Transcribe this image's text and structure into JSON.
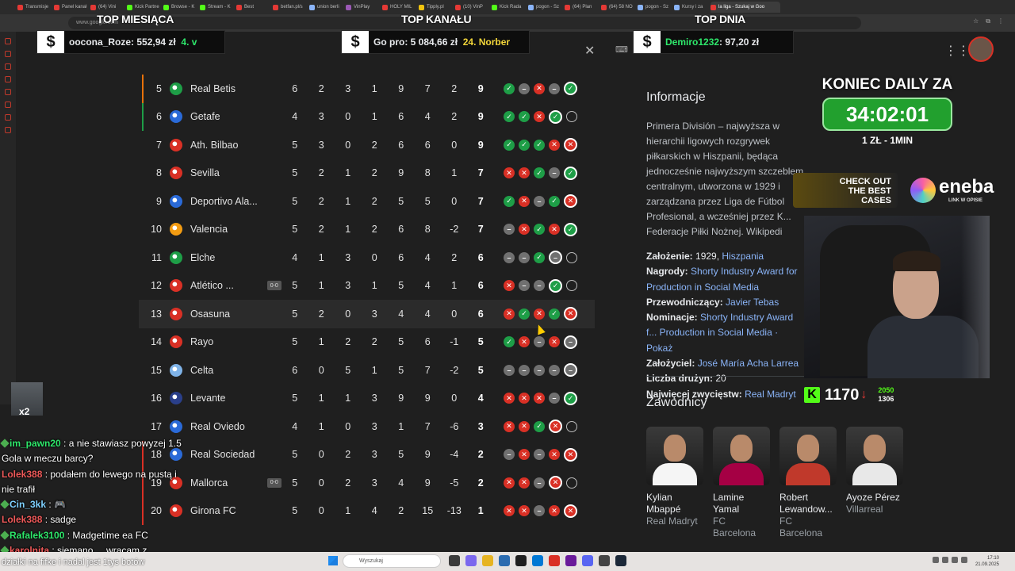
{
  "browser": {
    "tabs": [
      {
        "label": "Transmisje",
        "color": "#e53935"
      },
      {
        "label": "Panel kanał",
        "color": "#e53935"
      },
      {
        "label": "(64) Vini",
        "color": "#e53935"
      },
      {
        "label": "Kick Partne",
        "color": "#53fc18"
      },
      {
        "label": "Browse - K",
        "color": "#53fc18"
      },
      {
        "label": "Stream - K",
        "color": "#53fc18"
      },
      {
        "label": "Best",
        "color": "#e53935"
      },
      {
        "label": "betfan.pl/s",
        "color": "#e53935"
      },
      {
        "label": "union berli",
        "color": "#8ab4f8"
      },
      {
        "label": "VinPlay",
        "color": "#9b59b6"
      },
      {
        "label": "HOLY MIL",
        "color": "#e53935"
      },
      {
        "label": "Tipply.pl",
        "color": "#f1c40f"
      },
      {
        "label": "(10) VinP",
        "color": "#e53935"
      },
      {
        "label": "Kick Rada",
        "color": "#53fc18"
      },
      {
        "label": "pogon - Sz",
        "color": "#8ab4f8"
      },
      {
        "label": "(64) Plan",
        "color": "#e53935"
      },
      {
        "label": "(64) 58 NO",
        "color": "#e53935"
      },
      {
        "label": "pogon - Sz",
        "color": "#8ab4f8"
      },
      {
        "label": "Kursy i za",
        "color": "#8ab4f8"
      },
      {
        "label": "la liga - Szukaj w Goo",
        "color": "#e53935",
        "active": true
      }
    ],
    "address": "www.google.com"
  },
  "overlay": {
    "top_month": {
      "title": "TOP MIESIĄCA",
      "badge": "$",
      "name": "oocona_Roze",
      "amount": "552,94 zł",
      "extra": "4. v"
    },
    "top_channel": {
      "title": "TOP KANAŁU",
      "badge": "$",
      "name": "Go pro",
      "amount": "5 084,66 zł",
      "extra": "24. Norber"
    },
    "top_day": {
      "title": "TOP DNIA",
      "badge": "$",
      "name": "Demiro1232",
      "amount": "97,20 zł"
    },
    "daily": {
      "title": "KONIEC DAILY ZA",
      "timer": "34:02:01",
      "sub": "1 ZŁ - 1MIN"
    },
    "promo": {
      "case_text": "CHECK OUT THE BEST CASES",
      "eneba": "eneba",
      "eneba_sub": "LINK W OPISIE"
    },
    "kick": {
      "logo": "K",
      "followers": "1170",
      "arrow": "↓",
      "stat1": "2050",
      "stat2": "1306"
    },
    "chat_avatar_label": "x2"
  },
  "icons": {
    "close": "✕",
    "keyboard": "⌨",
    "apps": "⋮⋮⋮",
    "win": "W",
    "check": "✓",
    "cross": "✕",
    "dash": "–"
  },
  "table": {
    "rows": [
      {
        "pos": "5",
        "team": "Real Betis",
        "crest": "#1e9e47",
        "stripe": "#e8710a",
        "stats": [
          "6",
          "2",
          "3",
          "1",
          "9",
          "7",
          "2"
        ],
        "pts": "9",
        "form": [
          "W",
          "D",
          "L",
          "D",
          "Wb"
        ]
      },
      {
        "pos": "6",
        "team": "Getafe",
        "crest": "#2a6ad8",
        "stripe": "#1e9e47",
        "stats": [
          "4",
          "3",
          "0",
          "1",
          "6",
          "4",
          "2"
        ],
        "pts": "9",
        "form": [
          "W",
          "W",
          "L",
          "Wb",
          "N"
        ]
      },
      {
        "pos": "7",
        "team": "Ath. Bilbao",
        "crest": "#d93025",
        "stripe": "",
        "stats": [
          "5",
          "3",
          "0",
          "2",
          "6",
          "6",
          "0"
        ],
        "pts": "9",
        "form": [
          "W",
          "W",
          "W",
          "L",
          "Lb"
        ]
      },
      {
        "pos": "8",
        "team": "Sevilla",
        "crest": "#d93025",
        "stripe": "",
        "stats": [
          "5",
          "2",
          "1",
          "2",
          "9",
          "8",
          "1"
        ],
        "pts": "7",
        "form": [
          "L",
          "L",
          "W",
          "D",
          "Wb"
        ]
      },
      {
        "pos": "9",
        "team": "Deportivo Ala...",
        "crest": "#2a6ad8",
        "stripe": "",
        "stats": [
          "5",
          "2",
          "1",
          "2",
          "5",
          "5",
          "0"
        ],
        "pts": "7",
        "form": [
          "W",
          "L",
          "D",
          "W",
          "Lb"
        ]
      },
      {
        "pos": "10",
        "team": "Valencia",
        "crest": "#f39c12",
        "stripe": "",
        "stats": [
          "5",
          "2",
          "1",
          "2",
          "6",
          "8",
          "-2"
        ],
        "pts": "7",
        "form": [
          "D",
          "L",
          "W",
          "L",
          "Wb"
        ]
      },
      {
        "pos": "11",
        "team": "Elche",
        "crest": "#1e9e47",
        "stripe": "",
        "stats": [
          "4",
          "1",
          "3",
          "0",
          "6",
          "4",
          "2"
        ],
        "pts": "6",
        "form": [
          "D",
          "D",
          "W",
          "Db",
          "N"
        ]
      },
      {
        "pos": "12",
        "team": "Atlético ...",
        "live": "0-0",
        "crest": "#d93025",
        "stripe": "",
        "stats": [
          "5",
          "1",
          "3",
          "1",
          "5",
          "4",
          "1"
        ],
        "pts": "6",
        "form": [
          "L",
          "D",
          "D",
          "Wb",
          "N"
        ]
      },
      {
        "pos": "13",
        "team": "Osasuna",
        "crest": "#d93025",
        "stripe": "",
        "stats": [
          "5",
          "2",
          "0",
          "3",
          "4",
          "4",
          "0"
        ],
        "pts": "6",
        "form": [
          "L",
          "W",
          "L",
          "W",
          "Lb"
        ],
        "hl": true
      },
      {
        "pos": "14",
        "team": "Rayo",
        "crest": "#d93025",
        "stripe": "",
        "stats": [
          "5",
          "1",
          "2",
          "2",
          "5",
          "6",
          "-1"
        ],
        "pts": "5",
        "form": [
          "W",
          "L",
          "D",
          "L",
          "Db"
        ]
      },
      {
        "pos": "15",
        "team": "Celta",
        "crest": "#7fb3e8",
        "stripe": "",
        "stats": [
          "6",
          "0",
          "5",
          "1",
          "5",
          "7",
          "-2"
        ],
        "pts": "5",
        "form": [
          "D",
          "D",
          "D",
          "D",
          "Db"
        ]
      },
      {
        "pos": "16",
        "team": "Levante",
        "crest": "#2a3f8a",
        "stripe": "",
        "stats": [
          "5",
          "1",
          "1",
          "3",
          "9",
          "9",
          "0"
        ],
        "pts": "4",
        "form": [
          "L",
          "L",
          "L",
          "D",
          "Wb"
        ]
      },
      {
        "pos": "17",
        "team": "Real Oviedo",
        "crest": "#2a6ad8",
        "stripe": "",
        "stats": [
          "4",
          "1",
          "0",
          "3",
          "1",
          "7",
          "-6"
        ],
        "pts": "3",
        "form": [
          "L",
          "L",
          "W",
          "Lb",
          "N"
        ]
      },
      {
        "pos": "18",
        "team": "Real Sociedad",
        "crest": "#2a6ad8",
        "stripe": "#d93025",
        "stats": [
          "5",
          "0",
          "2",
          "3",
          "5",
          "9",
          "-4"
        ],
        "pts": "2",
        "form": [
          "D",
          "L",
          "D",
          "L",
          "Lb"
        ]
      },
      {
        "pos": "19",
        "team": "Mallorca",
        "live": "0-0",
        "crest": "#d93025",
        "stripe": "#d93025",
        "stats": [
          "5",
          "0",
          "2",
          "3",
          "4",
          "9",
          "-5"
        ],
        "pts": "2",
        "form": [
          "L",
          "L",
          "D",
          "Lb",
          "N"
        ]
      },
      {
        "pos": "20",
        "team": "Girona FC",
        "crest": "#d93025",
        "stripe": "#d93025",
        "stats": [
          "5",
          "0",
          "1",
          "4",
          "2",
          "15",
          "-13"
        ],
        "pts": "1",
        "form": [
          "L",
          "L",
          "D",
          "L",
          "Lb"
        ]
      }
    ]
  },
  "info": {
    "heading": "Informacje",
    "description": "Primera División – najwyższa w hierarchii ligowych rozgrywek piłkarskich w Hiszpanii, będąca jednocześnie najwyższym szczeblem centralnym, utworzona w 1929 i zarządzana przez Liga de Fútbol Profesional, a wcześniej przez K... Federacje Piłki Nożnej. Wikipedi",
    "facts": [
      {
        "k": "Założenie:",
        "v": "1929, ",
        "link": "Hiszpania"
      },
      {
        "k": "Nagrody:",
        "v": "",
        "link": "Shorty Industry Award for Production in Social Media"
      },
      {
        "k": "Przewodniczący:",
        "v": "",
        "link": "Javier Tebas"
      },
      {
        "k": "Nominacje:",
        "v": "",
        "link": "Shorty Industry Award f... Production in Social Media · Pokaż"
      },
      {
        "k": "Założyciel:",
        "v": "",
        "link": "José María Acha Larrea"
      },
      {
        "k": "Liczba drużyn:",
        "v": "20",
        "link": ""
      },
      {
        "k": "Najwięcej zwycięstw:",
        "v": "",
        "link": "Real Madryt"
      }
    ],
    "players_heading": "Zawodnicy",
    "players": [
      {
        "name": "Kylian Mbappé",
        "club": "Real Madryt",
        "shirt": "#f5f5f5"
      },
      {
        "name": "Lamine Yamal",
        "club": "FC Barcelona",
        "shirt": "#a50044"
      },
      {
        "name": "Robert Lewandow...",
        "club": "FC Barcelona",
        "shirt": "#c0392b"
      },
      {
        "name": "Ayoze Pérez",
        "club": "Villarreal",
        "shirt": "#e8e8e8"
      }
    ]
  },
  "chat": {
    "lines": [
      {
        "user": "im_pawn20",
        "cls": "u1",
        "icon": true,
        "text": " : a nie stawiasz powyzej 1.5 Gola w meczu barcy?"
      },
      {
        "user": "Lolek388",
        "cls": "u2",
        "icon": false,
        "text": " : podałem do lewego na pustą i nie trafił"
      },
      {
        "user": "Cin_3kk",
        "cls": "u3",
        "icon": true,
        "text": " : 🎮"
      },
      {
        "user": "Lolek388",
        "cls": "u2",
        "icon": false,
        "text": " : sadge"
      },
      {
        "user": "Rafalek3100",
        "cls": "u1",
        "icon": true,
        "text": " : Madgetime ea FC"
      },
      {
        "user": "karolnita",
        "cls": "u2",
        "icon": true,
        "text": " : siemano ... wracam z"
      }
    ],
    "bottom": "działki na fifke i nadal jest 1tys botów"
  },
  "taskbar": {
    "search_placeholder": "Wyszukaj",
    "time": "17:10",
    "date": "21.09.2025"
  }
}
